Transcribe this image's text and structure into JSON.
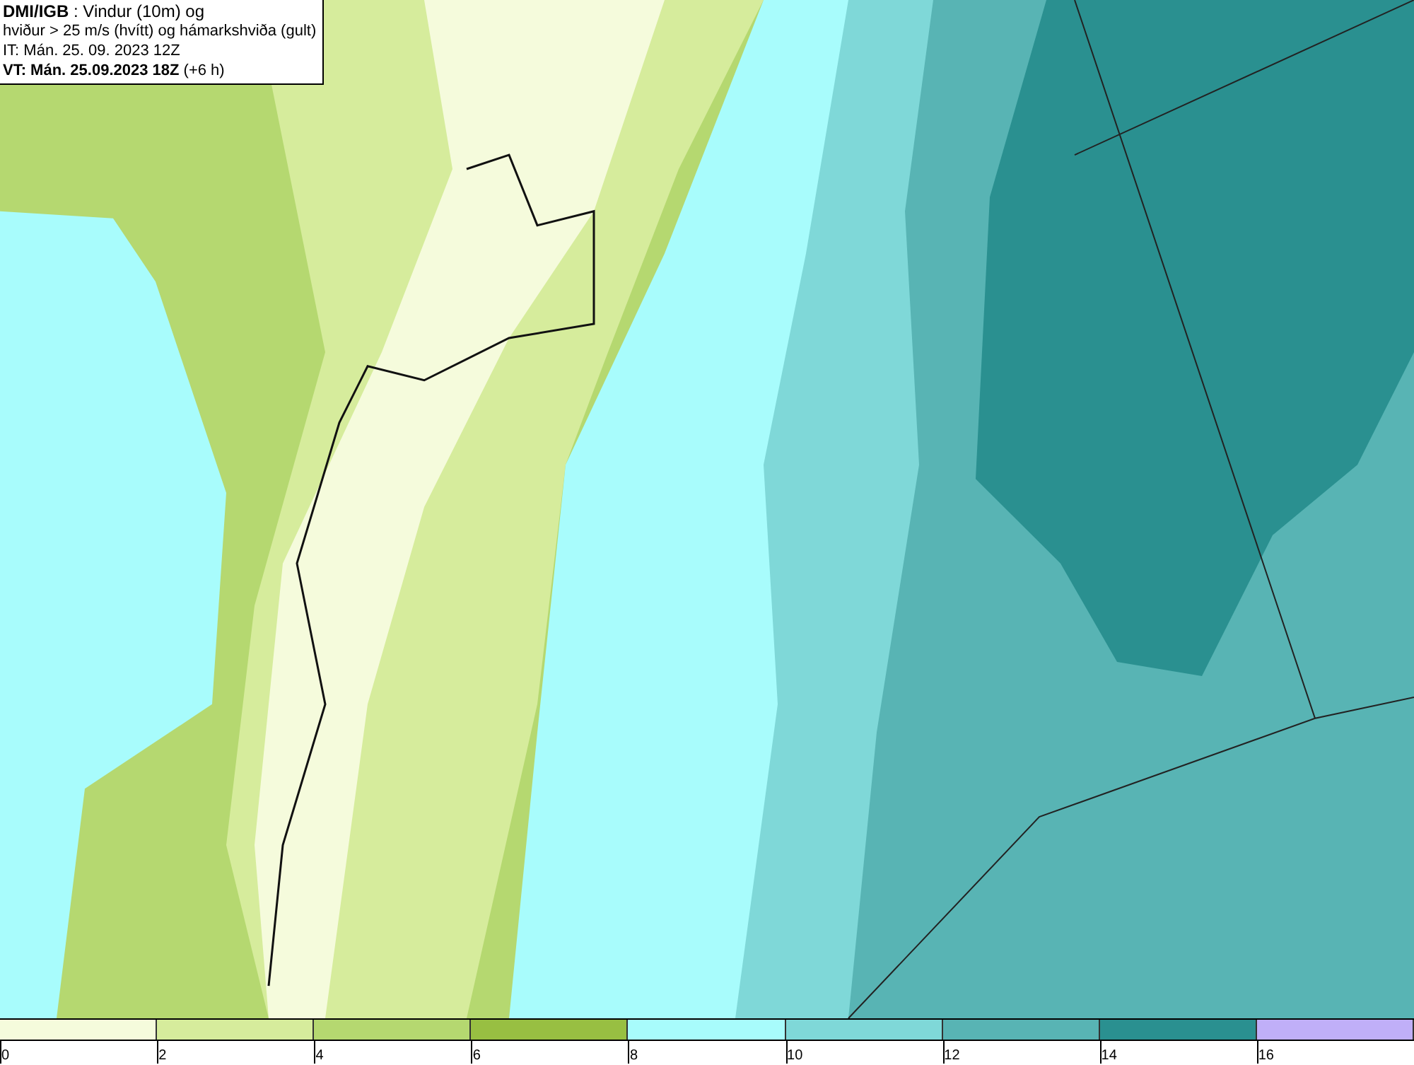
{
  "title_box": {
    "lines": [
      "**DMI/IGB** : Vindur (10m) og",
      "hviður > 25 m/s (hvítt) og hámarkshviða (gult)",
      "IT: Mán. 25. 09. 2023 12Z",
      "**VT: Mán. 25.09.2023 18Z** (+6 h)"
    ]
  },
  "legend": {
    "bins": [
      {
        "color": "#f5fbdc"
      },
      {
        "color": "#d6ec9c"
      },
      {
        "color": "#b5d870"
      },
      {
        "color": "#98bf42"
      },
      {
        "color": "#a8fcfc"
      },
      {
        "color": "#7fd8d8"
      },
      {
        "color": "#58b4b4"
      },
      {
        "color": "#2a9090"
      },
      {
        "color": "#c0aff8"
      }
    ],
    "ticks": [
      "0",
      "2",
      "4",
      "6",
      "8",
      "10",
      "12",
      "14",
      "16"
    ]
  }
}
